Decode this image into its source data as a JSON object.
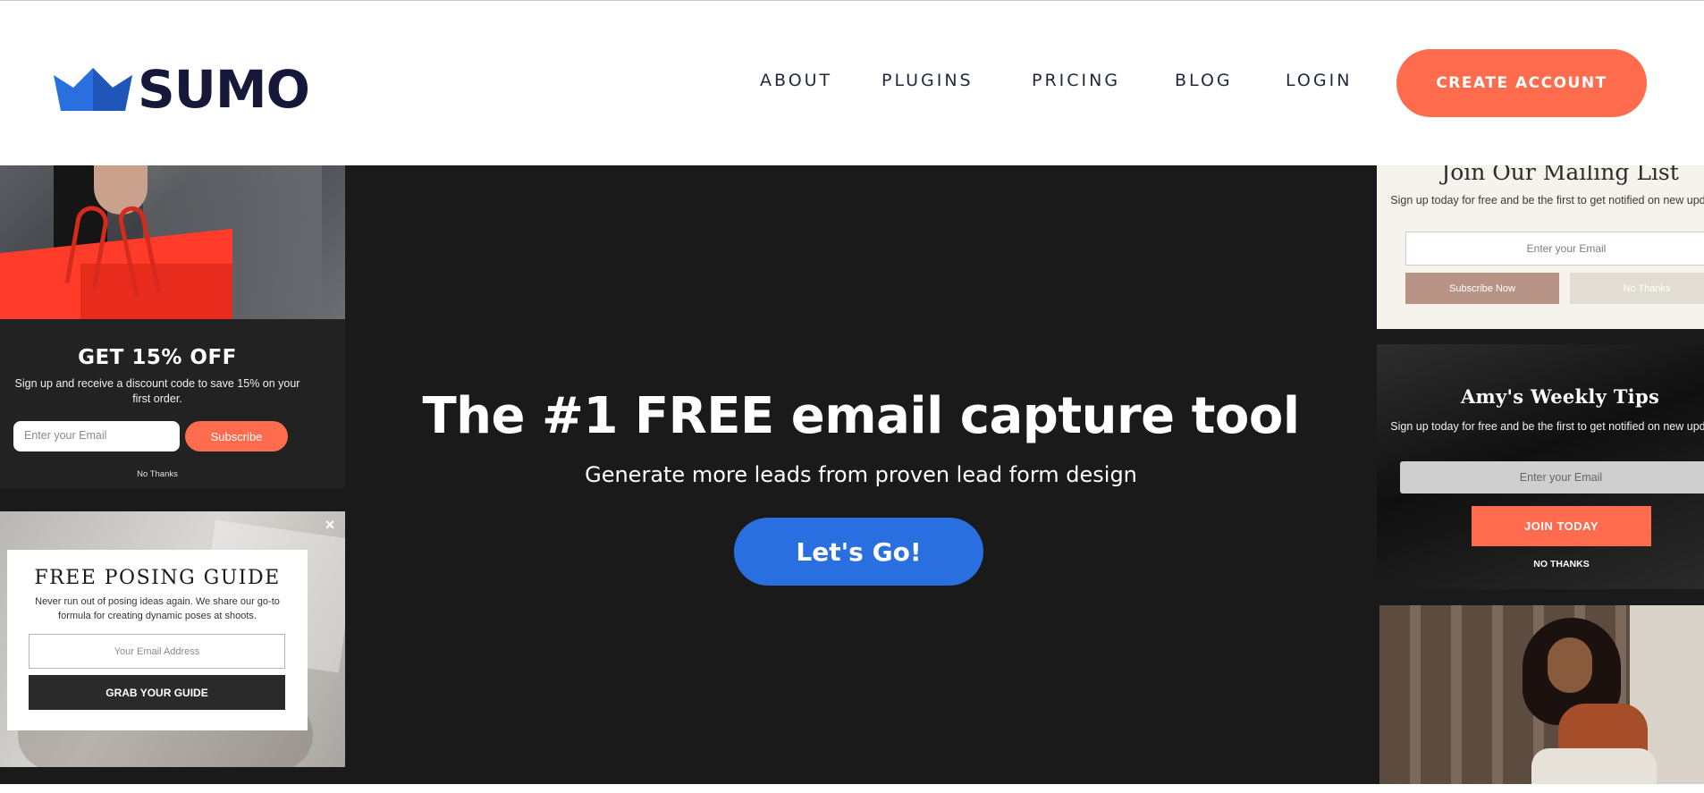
{
  "brand": {
    "name": "SUMO",
    "logo_icon": "crown-icon",
    "accent": "#ff6b4d",
    "logo_blue": "#2a6fe0",
    "navy": "#16183a"
  },
  "nav": {
    "items": [
      "ABOUT",
      "PLUGINS",
      "PRICING",
      "BLOG",
      "LOGIN"
    ],
    "cta": "CREATE ACCOUNT"
  },
  "hero": {
    "title": "The #1 FREE email capture tool",
    "subtitle": "Generate more leads from proven lead form design",
    "button": "Let's Go!"
  },
  "examples": {
    "discount": {
      "title": "GET 15% OFF",
      "description": "Sign up and receive a discount code to save 15% on your first order.",
      "email_placeholder": "Enter your Email",
      "button": "Subscribe",
      "dismiss": "No Thanks"
    },
    "posing": {
      "close": "×",
      "title": "FREE POSING GUIDE",
      "description": "Never run out of posing ideas again. We share our go-to formula for creating dynamic poses at shoots.",
      "email_placeholder": "Your Email Address",
      "button": "GRAB YOUR GUIDE"
    },
    "mailing": {
      "title": "Join Our Mailing List",
      "description": "Sign up today for free and be the first to get notified on new updates.",
      "email_placeholder": "Enter your Email",
      "button": "Subscribe Now",
      "dismiss": "No Thanks"
    },
    "tips": {
      "title": "Amy's Weekly Tips",
      "description": "Sign up today for free and be the first to get notified on new updates.",
      "email_placeholder": "Enter your Email",
      "button": "JOIN TODAY",
      "dismiss": "NO THANKS"
    }
  }
}
